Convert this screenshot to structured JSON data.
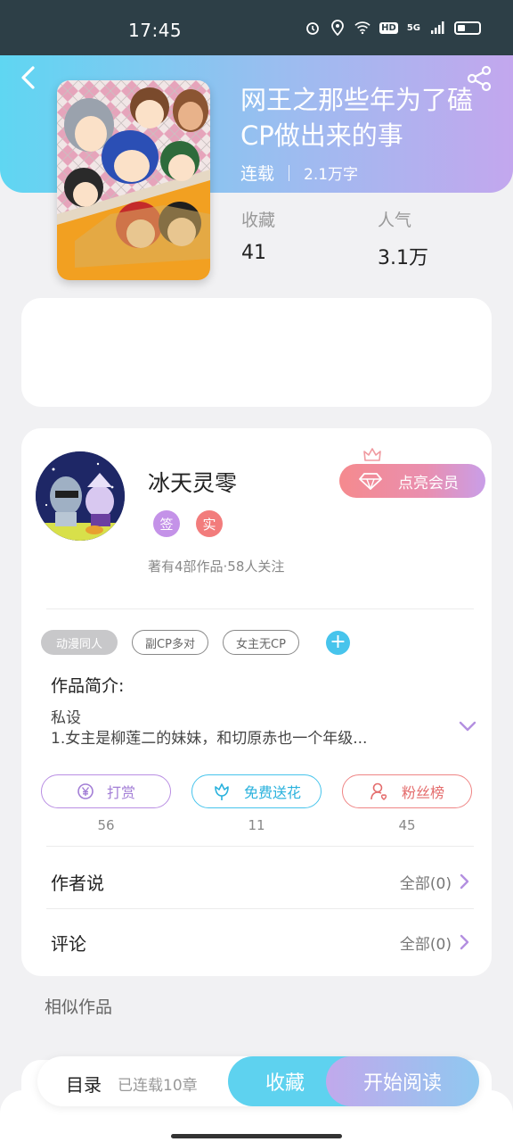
{
  "status_bar": {
    "time": "17:45",
    "network": "5G",
    "hd": "HD"
  },
  "book": {
    "title": "网王之那些年为了磕CP做出来的事",
    "status": "连载",
    "word_count": "2.1万字",
    "stats": [
      {
        "label": "收藏",
        "value": "41"
      },
      {
        "label": "人气",
        "value": "3.1万"
      }
    ]
  },
  "author": {
    "name": "冰天灵零",
    "badges": [
      "签",
      "实"
    ],
    "info": "著有4部作品·58人关注",
    "vip_button": "点亮会员"
  },
  "tags": [
    "动漫同人",
    "副CP多对",
    "女主无CP"
  ],
  "intro": {
    "label": "作品简介:",
    "line1": "私设",
    "line2": "1.女主是柳莲二的妹妹，和切原赤也一个年级..."
  },
  "actions": [
    {
      "label": "打赏",
      "count": "56",
      "icon": "yen-icon"
    },
    {
      "label": "免费送花",
      "count": "11",
      "icon": "flower-icon"
    },
    {
      "label": "粉丝榜",
      "count": "45",
      "icon": "fan-icon"
    }
  ],
  "rows": [
    {
      "title": "作者说",
      "right": "全部(0)"
    },
    {
      "title": "评论",
      "right": "全部(0)"
    }
  ],
  "similar_label": "相似作品",
  "bottom_bar": {
    "toc": "目录",
    "chapters": "已连载10章",
    "favorite": "收藏",
    "read": "开始阅读"
  },
  "colors": {
    "header_start": "#5fd6f2",
    "header_end": "#c3a7ee",
    "accent_blue": "#47c4ec",
    "accent_purple": "#b98ee3",
    "accent_red": "#ef8585"
  }
}
